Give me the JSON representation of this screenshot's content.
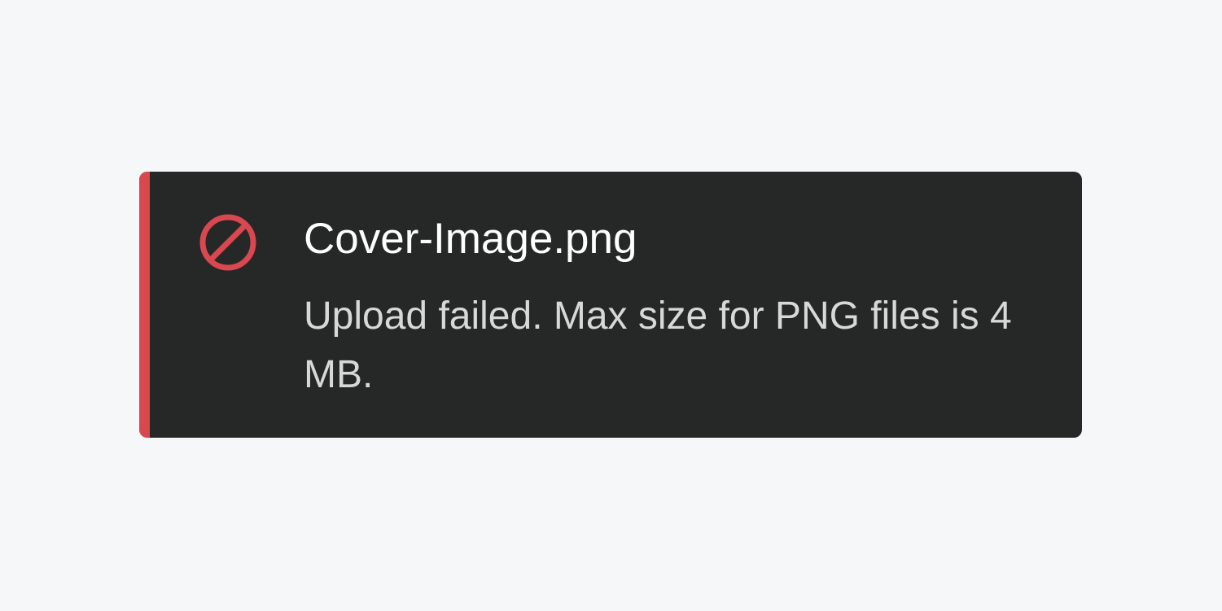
{
  "toast": {
    "type": "error",
    "icon": "prohibited-icon",
    "title": "Cover-Image.png",
    "message": "Upload failed. Max size for PNG files is 4 MB.",
    "colors": {
      "background": "#262727",
      "accent": "#d9474f",
      "title": "#ffffff",
      "message": "#d8d8d8",
      "page": "#f6f7f9"
    }
  }
}
